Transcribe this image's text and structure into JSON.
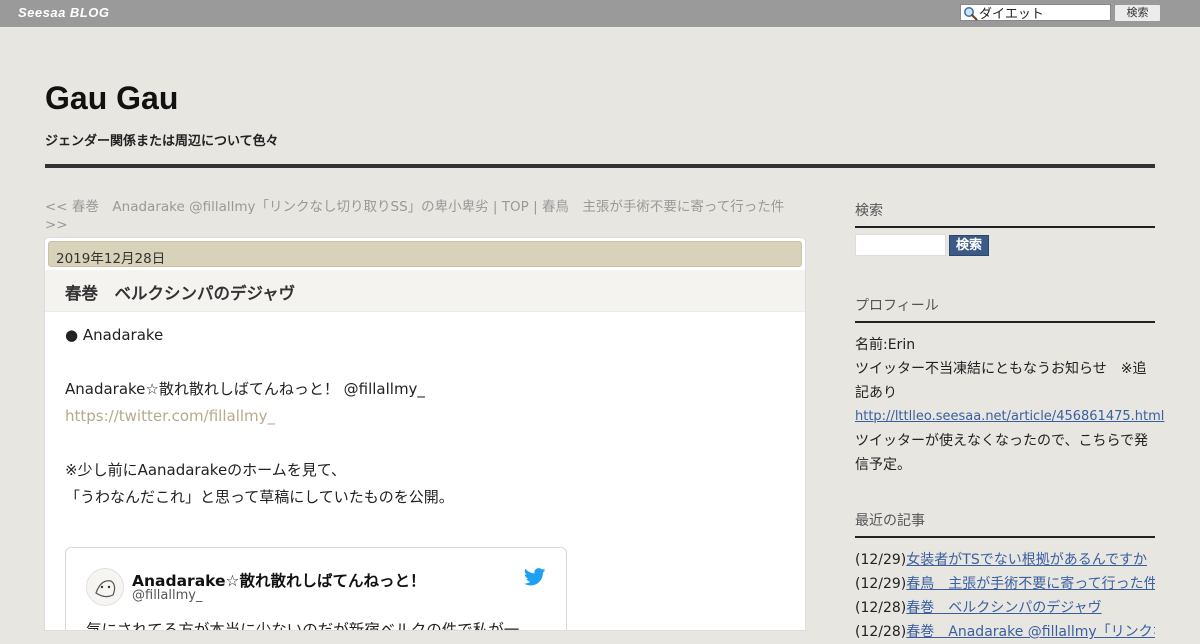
{
  "topbar": {
    "logo": "Seesaa BLOG",
    "search_value": "ダイエット",
    "search_button": "検索"
  },
  "header": {
    "title": "Gau Gau",
    "subtitle": "ジェンダー関係または周辺について色々"
  },
  "nav": {
    "prev": "<< 春巻　Anadarake @fillallmy「リンクなし切り取りSS」の卑小卑劣",
    "sep1": " | ",
    "top": "TOP",
    "sep2": " | ",
    "next": "春鳥　主張が手術不要に寄って行った件 >>"
  },
  "article": {
    "date": "2019年12月28日",
    "title": "春巻　ベルクシンパのデジャヴ",
    "lines": {
      "l1": "● Anadarake",
      "l2": "Anadarake☆散れ散れしばてんねっと！ @fillallmy_",
      "l3": "https://twitter.com/fillallmy_",
      "l4": "※少し前にAanadarakeのホームを見て、",
      "l5": "「うわなんだこれ」と思って草稿にしていたものを公開。"
    },
    "tweet": {
      "name": "Anadarake☆散れ散れしばてんねっと！",
      "handle": "@fillallmy_",
      "text": "気にされてる方が本当に少ないのだが新宿ベルクの件で私が一"
    }
  },
  "sidebar": {
    "search_heading": "検索",
    "search_button": "検索",
    "profile_heading": "プロフィール",
    "profile_name": "名前:Erin",
    "profile_line1": "ツイッター不当凍結にともなうお知らせ　※追記あり",
    "profile_link": "http://lttlleo.seesaa.net/article/456861475.html",
    "profile_line2": "ツイッターが使えなくなったので、こちらで発信予定。",
    "recent_heading": "最近の記事",
    "recent": [
      {
        "date": "(12/29)",
        "title": "女装者がTSでない根拠があるんですか"
      },
      {
        "date": "(12/29)",
        "title": "春鳥　主張が手術不要に寄って行った件"
      },
      {
        "date": "(12/28)",
        "title": "春巻　ベルクシンパのデジャヴ"
      },
      {
        "date": "(12/28)",
        "title": "春巻　Anadarake @fillallmy「リンクな"
      }
    ]
  },
  "colors": {
    "topbar": "#9a9a9a",
    "background": "#e8e6e1",
    "date_bar": "#d8d2bb",
    "link_blue": "#3a5fa0",
    "search_button": "#3b5a86"
  }
}
